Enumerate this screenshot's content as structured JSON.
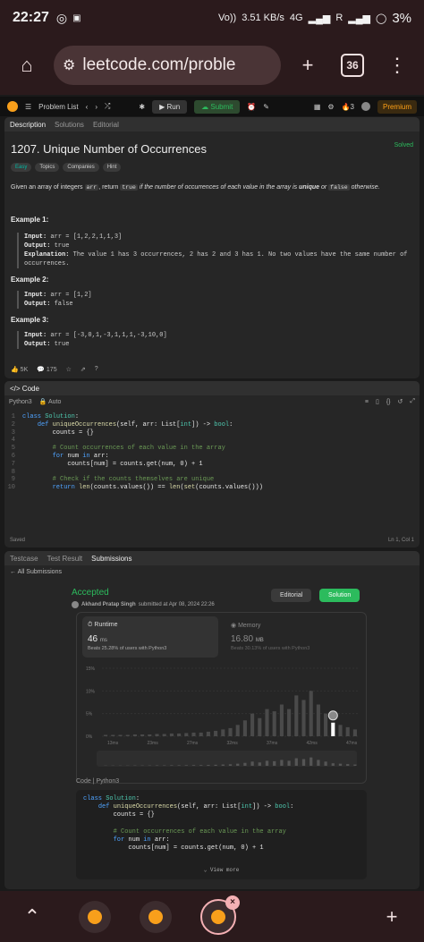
{
  "status": {
    "time": "22:27",
    "net1": "Vo))",
    "net2": "3.51 KB/s",
    "sig": "4G",
    "carrier": "R",
    "battery": "3%"
  },
  "browser": {
    "url": "leetcode.com/proble",
    "tab_count": "36"
  },
  "lc_nav": {
    "problem_list": "Problem List",
    "run": "Run",
    "submit": "Submit",
    "streak": "3",
    "premium": "Premium"
  },
  "desc_tabs": {
    "description": "Description",
    "solutions": "Solutions",
    "editorial": "Editorial"
  },
  "problem": {
    "title": "1207. Unique Number of Occurrences",
    "solved": "Solved",
    "tags": [
      "Easy",
      "Topics",
      "Companies",
      "Hint"
    ],
    "text_before": "Given an array of integers ",
    "arr": "arr",
    "text_mid": ", return ",
    "true": "true",
    "text_italic": " if the number of occurrences of each value in the array is ",
    "unique": "unique",
    "or": " or ",
    "false": "false",
    "otherwise": " otherwise.",
    "examples": [
      {
        "title": "Example 1:",
        "input": "arr = [1,2,2,1,1,3]",
        "output": "true",
        "explanation": "The value 1 has 3 occurrences, 2 has 2 and 3 has 1. No two values have the same number of occurrences."
      },
      {
        "title": "Example 2:",
        "input": "arr = [1,2]",
        "output": "false"
      },
      {
        "title": "Example 3:",
        "input": "arr = [-3,0,1,-3,1,1,1,-3,10,0]",
        "output": "true"
      }
    ],
    "likes": "5K",
    "comments": "175"
  },
  "code_panel": {
    "title": "Code",
    "language": "Python3",
    "auto": "Auto",
    "saved": "Saved",
    "position": "Ln 1, Col 1"
  },
  "result_tabs": {
    "testcase": "Testcase",
    "test_result": "Test Result",
    "submissions": "Submissions"
  },
  "submission": {
    "back": "All Submissions",
    "status": "Accepted",
    "author": "Akhand Pratap Singh",
    "submitted": "submitted at Apr 08, 2024 22:26",
    "editorial_btn": "Editorial",
    "solution_btn": "Solution",
    "runtime_label": "Runtime",
    "runtime_value": "46",
    "runtime_unit": "ms",
    "runtime_beats": "Beats 25.28% of users with Python3",
    "memory_label": "Memory",
    "memory_value": "16.80",
    "memory_unit": "MB",
    "memory_beats": "Beats 30.13% of users with Python3",
    "code_label": "Code",
    "code_lang": "Python3",
    "view_more": "View more"
  },
  "chart_data": {
    "type": "bar",
    "yticks": [
      "15%",
      "10%",
      "5%",
      "0%"
    ],
    "xticks": [
      "13ms",
      "23ms",
      "27ms",
      "32ms",
      "37ms",
      "42ms",
      "47ms"
    ],
    "ylim": [
      0,
      15
    ],
    "values": [
      0.3,
      0.3,
      0.3,
      0.3,
      0.4,
      0.4,
      0.4,
      0.5,
      0.5,
      0.6,
      0.6,
      0.7,
      0.8,
      0.8,
      1,
      1.2,
      1.5,
      1.8,
      2.5,
      3.5,
      5,
      4,
      6,
      5.5,
      7,
      6,
      9,
      8,
      10,
      7,
      5,
      3,
      2.5,
      2,
      1.5
    ],
    "highlight_index": 31,
    "highlight_color": "#ffffff"
  },
  "colors": {
    "accent": "#ffa116",
    "green": "#2cbb5d",
    "bg": "#1a1a1a"
  }
}
